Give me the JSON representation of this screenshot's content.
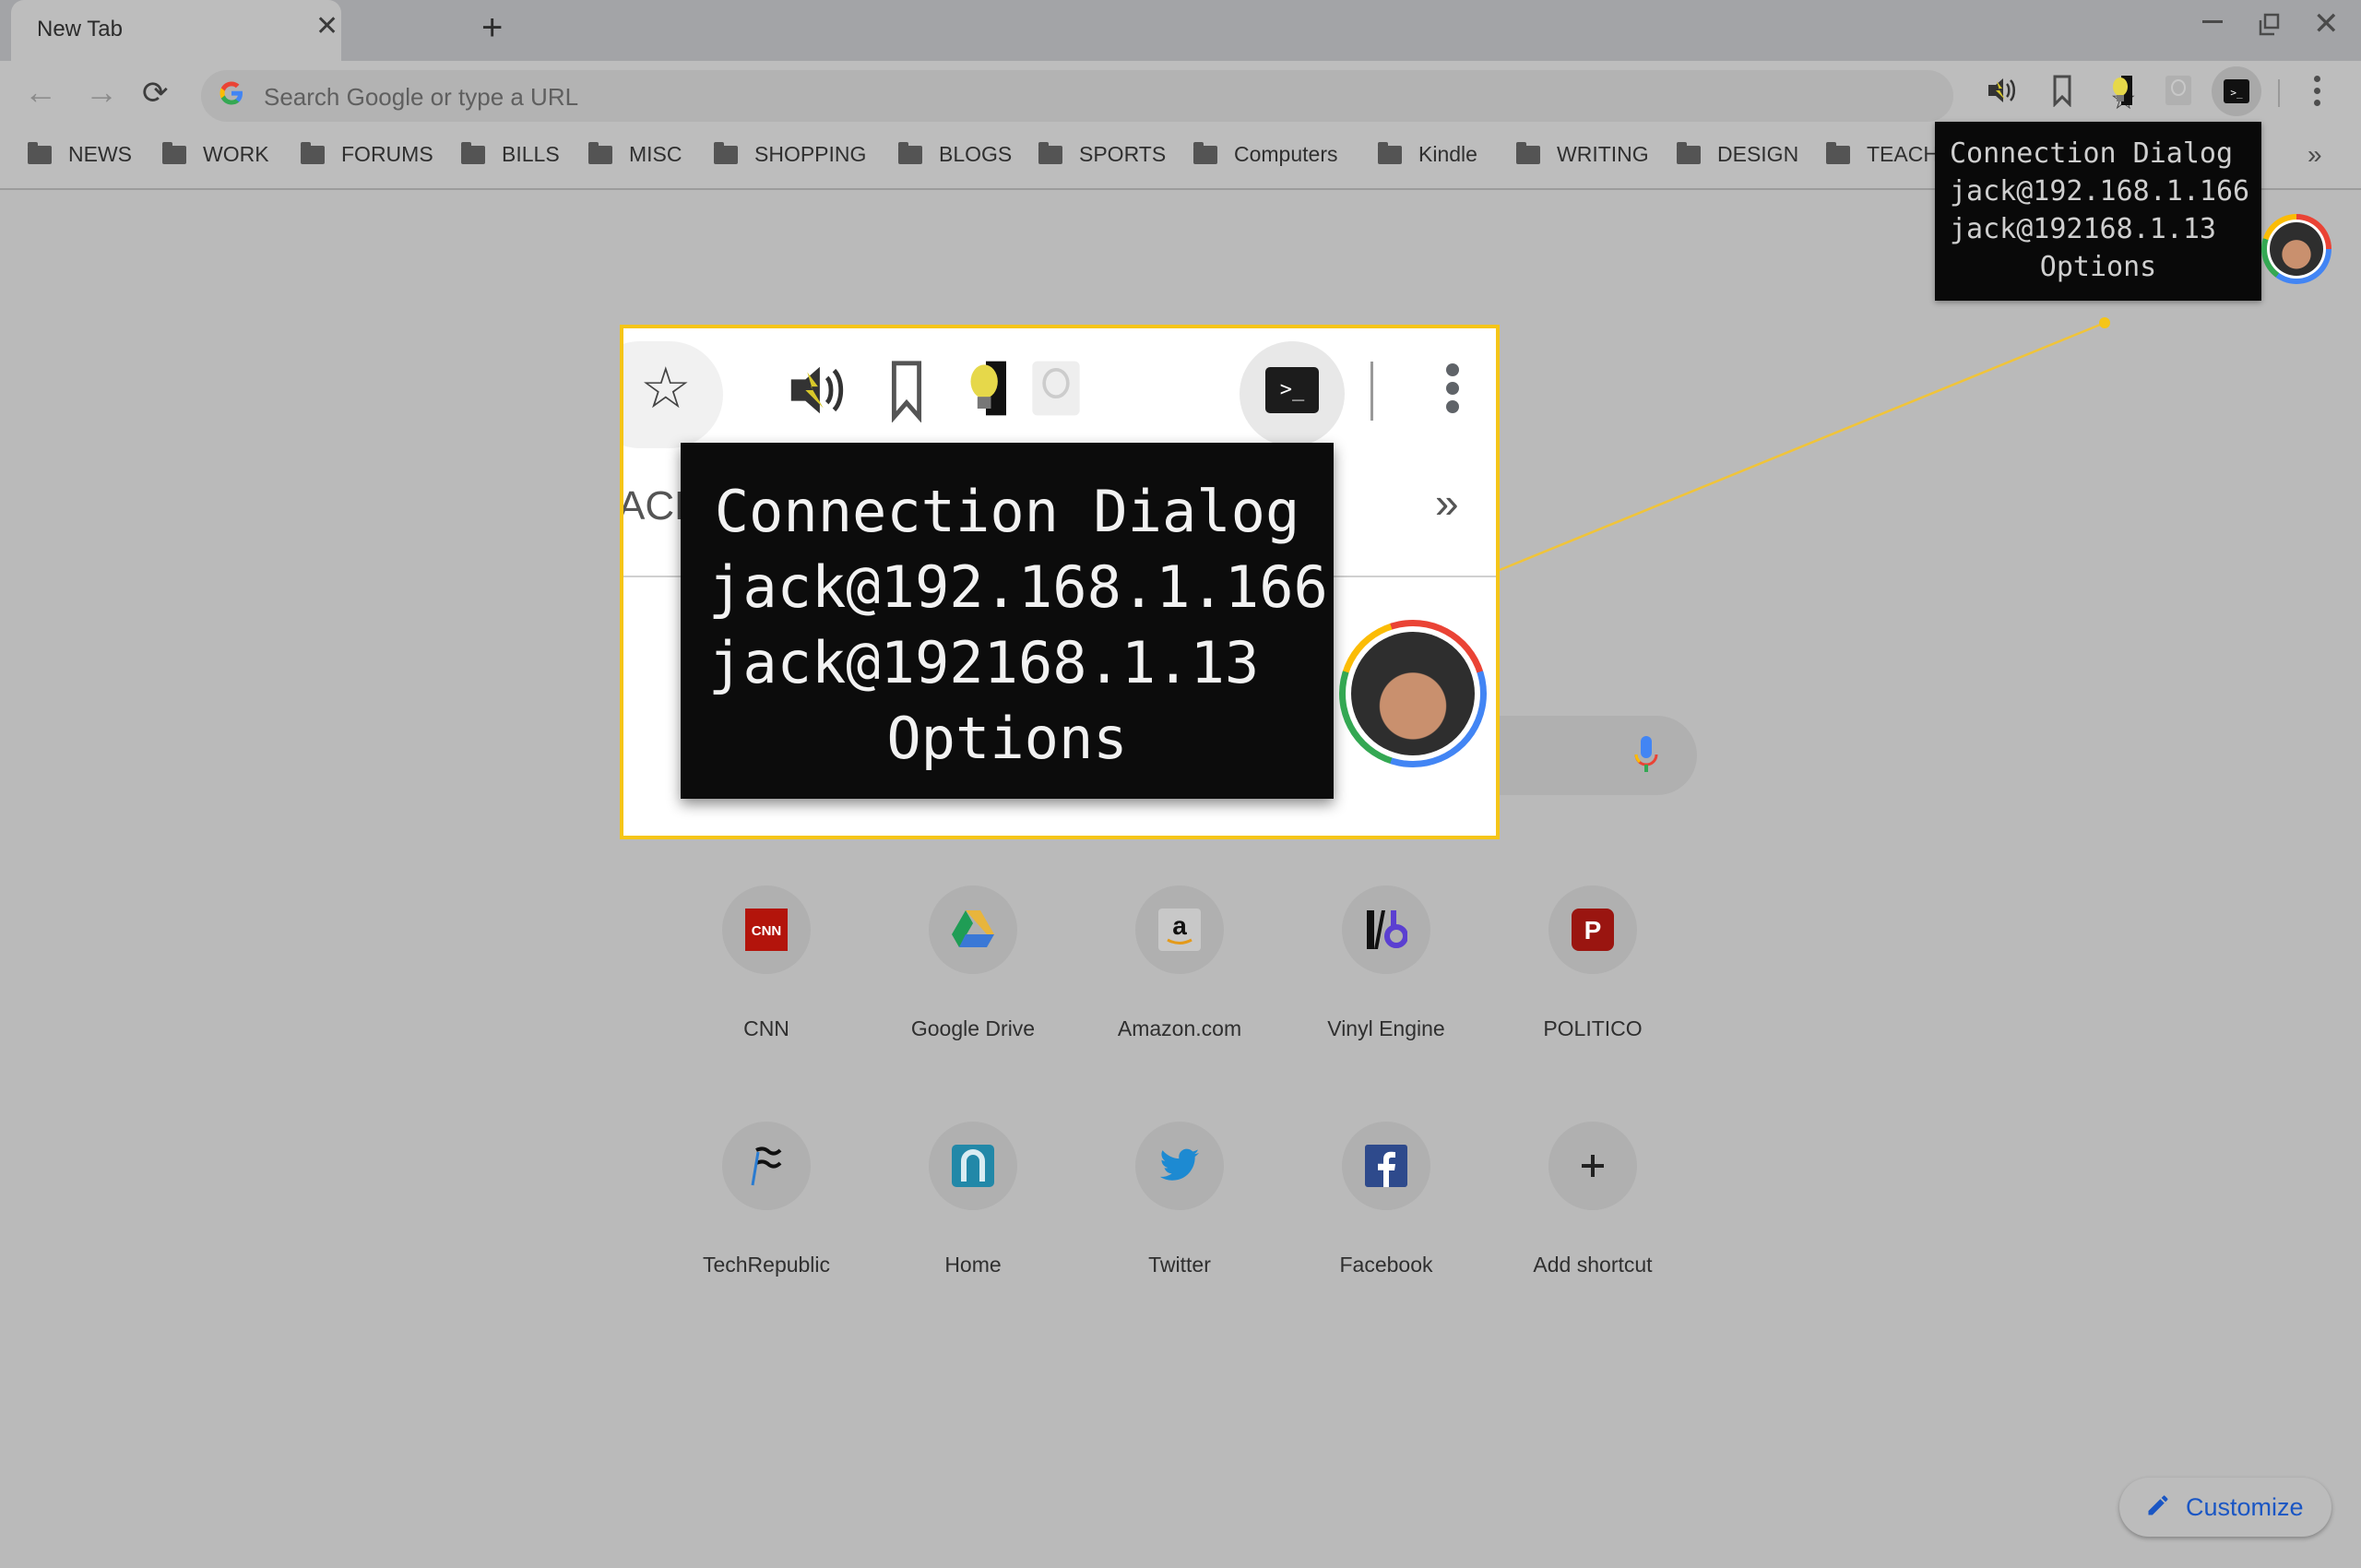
{
  "window": {
    "tab_title": "New Tab",
    "tab_close_icon": "close-icon",
    "new_tab_icon": "plus-icon",
    "controls": [
      "minimize-icon",
      "restore-icon",
      "close-icon"
    ]
  },
  "toolbar": {
    "back_icon": "←",
    "forward_icon": "→",
    "reload_icon": "⟳",
    "omnibox_placeholder": "Search Google or type a URL",
    "omnibox_value": "",
    "google_logo": "G",
    "star_icon": "☆",
    "extensions": [
      {
        "name": "sound-extension-icon"
      },
      {
        "name": "bookmark-extension-icon"
      },
      {
        "name": "lightbulb-extension-icon"
      },
      {
        "name": "lightbulb-disabled-extension-icon"
      },
      {
        "name": "terminal-extension-icon",
        "glyph": ">_"
      }
    ],
    "more_menu_icon": "more-vert-icon"
  },
  "bookmarks": {
    "items": [
      {
        "label": "NEWS"
      },
      {
        "label": "WORK"
      },
      {
        "label": "FORUMS"
      },
      {
        "label": "BILLS"
      },
      {
        "label": "MISC"
      },
      {
        "label": "SHOPPING"
      },
      {
        "label": "BLOGS"
      },
      {
        "label": "SPORTS"
      },
      {
        "label": "Computers"
      },
      {
        "label": "Kindle"
      },
      {
        "label": "WRITING"
      },
      {
        "label": "DESIGN"
      },
      {
        "label": "TEACH"
      }
    ],
    "overflow": "»"
  },
  "tooltip": {
    "title": "Connection Dialog",
    "lines": [
      "jack@192.168.1.166",
      "jack@192168.1.13"
    ],
    "options": "Options"
  },
  "callout": {
    "truncated_bookmark": "ACH",
    "overflow": "»",
    "terminal_glyph": ">_",
    "star": "☆",
    "highlight_color": "#f5c518"
  },
  "shortcuts": [
    {
      "label": "CNN",
      "icon": "cnn-icon"
    },
    {
      "label": "Google Drive",
      "icon": "google-drive-icon"
    },
    {
      "label": "Amazon.com",
      "icon": "amazon-icon"
    },
    {
      "label": "Vinyl Engine",
      "icon": "vinyl-engine-icon"
    },
    {
      "label": "POLITICO",
      "icon": "politico-icon"
    },
    {
      "label": "TechRepublic",
      "icon": "techrepublic-icon"
    },
    {
      "label": "Home",
      "icon": "home-icon"
    },
    {
      "label": "Twitter",
      "icon": "twitter-icon"
    },
    {
      "label": "Facebook",
      "icon": "facebook-icon"
    },
    {
      "label": "Add shortcut",
      "icon": "plus-icon"
    }
  ],
  "customize": {
    "label": "Customize",
    "color": "#1a56c4"
  }
}
